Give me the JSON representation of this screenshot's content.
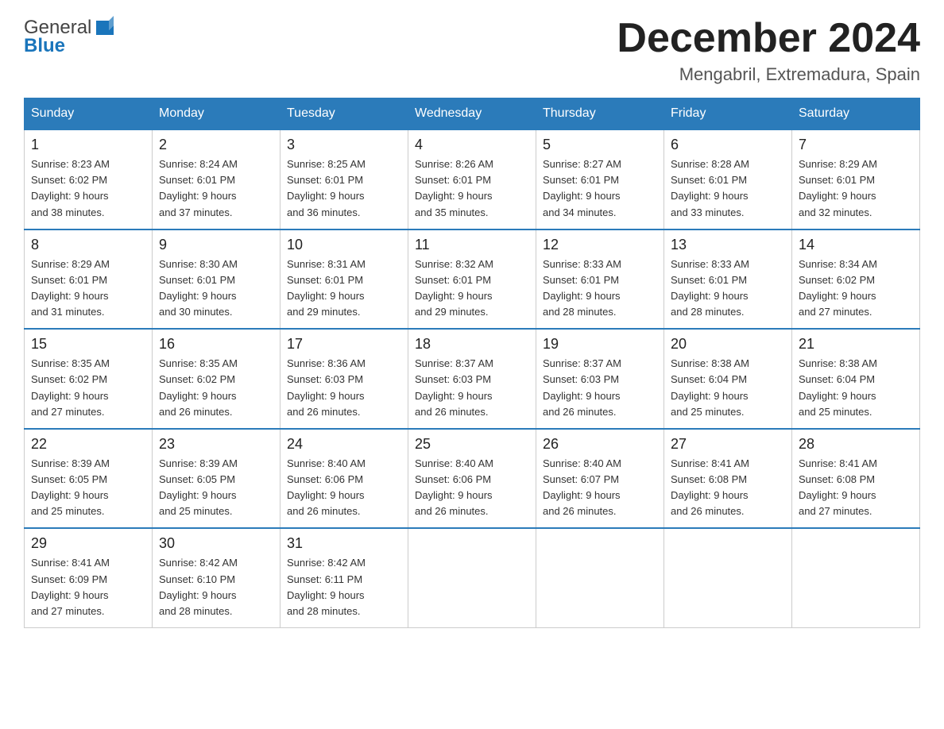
{
  "header": {
    "logo_general": "General",
    "logo_blue": "Blue",
    "month_title": "December 2024",
    "location": "Mengabril, Extremadura, Spain"
  },
  "days_of_week": [
    "Sunday",
    "Monday",
    "Tuesday",
    "Wednesday",
    "Thursday",
    "Friday",
    "Saturday"
  ],
  "weeks": [
    [
      {
        "day": "1",
        "sunrise": "8:23 AM",
        "sunset": "6:02 PM",
        "daylight": "9 hours and 38 minutes."
      },
      {
        "day": "2",
        "sunrise": "8:24 AM",
        "sunset": "6:01 PM",
        "daylight": "9 hours and 37 minutes."
      },
      {
        "day": "3",
        "sunrise": "8:25 AM",
        "sunset": "6:01 PM",
        "daylight": "9 hours and 36 minutes."
      },
      {
        "day": "4",
        "sunrise": "8:26 AM",
        "sunset": "6:01 PM",
        "daylight": "9 hours and 35 minutes."
      },
      {
        "day": "5",
        "sunrise": "8:27 AM",
        "sunset": "6:01 PM",
        "daylight": "9 hours and 34 minutes."
      },
      {
        "day": "6",
        "sunrise": "8:28 AM",
        "sunset": "6:01 PM",
        "daylight": "9 hours and 33 minutes."
      },
      {
        "day": "7",
        "sunrise": "8:29 AM",
        "sunset": "6:01 PM",
        "daylight": "9 hours and 32 minutes."
      }
    ],
    [
      {
        "day": "8",
        "sunrise": "8:29 AM",
        "sunset": "6:01 PM",
        "daylight": "9 hours and 31 minutes."
      },
      {
        "day": "9",
        "sunrise": "8:30 AM",
        "sunset": "6:01 PM",
        "daylight": "9 hours and 30 minutes."
      },
      {
        "day": "10",
        "sunrise": "8:31 AM",
        "sunset": "6:01 PM",
        "daylight": "9 hours and 29 minutes."
      },
      {
        "day": "11",
        "sunrise": "8:32 AM",
        "sunset": "6:01 PM",
        "daylight": "9 hours and 29 minutes."
      },
      {
        "day": "12",
        "sunrise": "8:33 AM",
        "sunset": "6:01 PM",
        "daylight": "9 hours and 28 minutes."
      },
      {
        "day": "13",
        "sunrise": "8:33 AM",
        "sunset": "6:01 PM",
        "daylight": "9 hours and 28 minutes."
      },
      {
        "day": "14",
        "sunrise": "8:34 AM",
        "sunset": "6:02 PM",
        "daylight": "9 hours and 27 minutes."
      }
    ],
    [
      {
        "day": "15",
        "sunrise": "8:35 AM",
        "sunset": "6:02 PM",
        "daylight": "9 hours and 27 minutes."
      },
      {
        "day": "16",
        "sunrise": "8:35 AM",
        "sunset": "6:02 PM",
        "daylight": "9 hours and 26 minutes."
      },
      {
        "day": "17",
        "sunrise": "8:36 AM",
        "sunset": "6:03 PM",
        "daylight": "9 hours and 26 minutes."
      },
      {
        "day": "18",
        "sunrise": "8:37 AM",
        "sunset": "6:03 PM",
        "daylight": "9 hours and 26 minutes."
      },
      {
        "day": "19",
        "sunrise": "8:37 AM",
        "sunset": "6:03 PM",
        "daylight": "9 hours and 26 minutes."
      },
      {
        "day": "20",
        "sunrise": "8:38 AM",
        "sunset": "6:04 PM",
        "daylight": "9 hours and 25 minutes."
      },
      {
        "day": "21",
        "sunrise": "8:38 AM",
        "sunset": "6:04 PM",
        "daylight": "9 hours and 25 minutes."
      }
    ],
    [
      {
        "day": "22",
        "sunrise": "8:39 AM",
        "sunset": "6:05 PM",
        "daylight": "9 hours and 25 minutes."
      },
      {
        "day": "23",
        "sunrise": "8:39 AM",
        "sunset": "6:05 PM",
        "daylight": "9 hours and 25 minutes."
      },
      {
        "day": "24",
        "sunrise": "8:40 AM",
        "sunset": "6:06 PM",
        "daylight": "9 hours and 26 minutes."
      },
      {
        "day": "25",
        "sunrise": "8:40 AM",
        "sunset": "6:06 PM",
        "daylight": "9 hours and 26 minutes."
      },
      {
        "day": "26",
        "sunrise": "8:40 AM",
        "sunset": "6:07 PM",
        "daylight": "9 hours and 26 minutes."
      },
      {
        "day": "27",
        "sunrise": "8:41 AM",
        "sunset": "6:08 PM",
        "daylight": "9 hours and 26 minutes."
      },
      {
        "day": "28",
        "sunrise": "8:41 AM",
        "sunset": "6:08 PM",
        "daylight": "9 hours and 27 minutes."
      }
    ],
    [
      {
        "day": "29",
        "sunrise": "8:41 AM",
        "sunset": "6:09 PM",
        "daylight": "9 hours and 27 minutes."
      },
      {
        "day": "30",
        "sunrise": "8:42 AM",
        "sunset": "6:10 PM",
        "daylight": "9 hours and 28 minutes."
      },
      {
        "day": "31",
        "sunrise": "8:42 AM",
        "sunset": "6:11 PM",
        "daylight": "9 hours and 28 minutes."
      },
      null,
      null,
      null,
      null
    ]
  ]
}
